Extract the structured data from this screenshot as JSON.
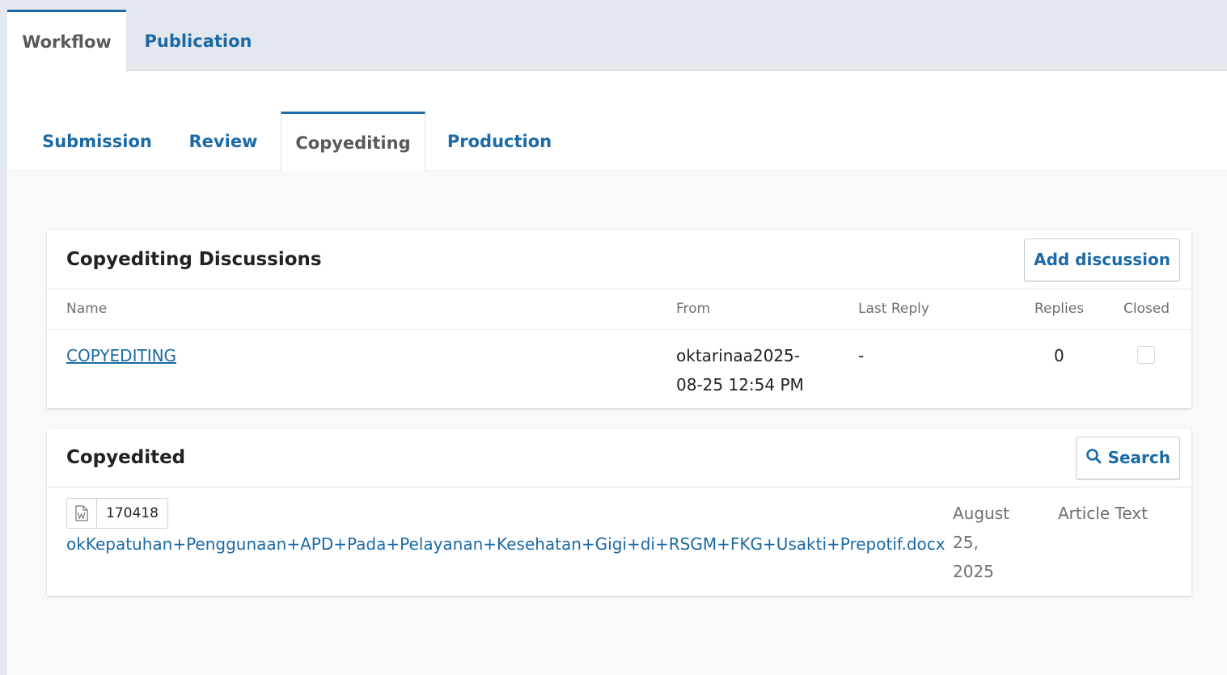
{
  "top_tabs": [
    {
      "label": "Workflow",
      "active": true
    },
    {
      "label": "Publication",
      "active": false
    }
  ],
  "stage_tabs": [
    {
      "label": "Submission",
      "active": false
    },
    {
      "label": "Review",
      "active": false
    },
    {
      "label": "Copyediting",
      "active": true
    },
    {
      "label": "Production",
      "active": false
    }
  ],
  "discussions": {
    "title": "Copyediting Discussions",
    "add_button_label": "Add discussion",
    "columns": {
      "name": "Name",
      "from": "From",
      "last_reply": "Last Reply",
      "replies": "Replies",
      "closed": "Closed"
    },
    "rows": [
      {
        "name": "COPYEDITING",
        "from_line1": "oktarinaa2025-",
        "from_line2": "08-25 12:54 PM",
        "last_reply": "-",
        "replies": "0",
        "closed": false
      }
    ]
  },
  "copyedited": {
    "title": "Copyedited",
    "search_button_label": "Search",
    "files": [
      {
        "file_icon": "word-document-icon",
        "id": "170418",
        "name": "okKepatuhan+Penggunaan+APD+Pada+Pelayanan+Kesehatan+Gigi+di+RSGM+FKG+Usakti+Prepotif.docx",
        "date_line1": "August",
        "date_line2": "25,",
        "date_line3": "2025",
        "type": "Article Text"
      }
    ]
  },
  "colors": {
    "accent": "#1b6aa5",
    "tab_bar_bg": "#e3e8ee",
    "muted_text": "#707070"
  }
}
